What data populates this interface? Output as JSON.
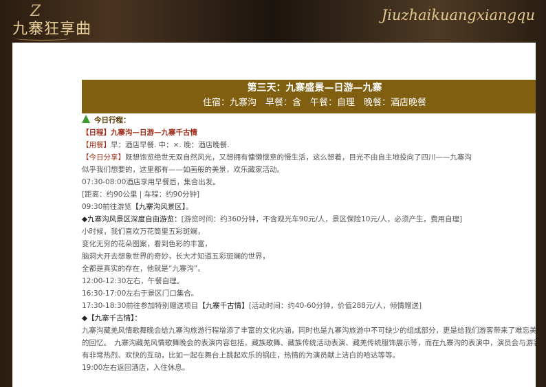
{
  "banner": {
    "logo_seal": "Z",
    "logo_title": "九寨狂享曲",
    "logo_script": "Jiuzhaikuangxiangqu"
  },
  "day": {
    "title": "第三天：九寨盛景—日游—九寨",
    "meta": "住宿：九寨沟　早餐：含　午餐：自理　晚餐：酒店晚餐"
  },
  "itinerary": {
    "today_label": "今日行程：",
    "schedule_prefix": "【日程】",
    "schedule_text": "九寨沟—日游—九寨千古情",
    "meal_prefix": "【用餐】",
    "meal_text": "早：酒店早餐. 中：×. 晚：酒店晚餐.",
    "share_prefix": "【今日分享】",
    "share_text_1": "既想饱览绝世无双自然风光，又想拥有慵懒惬意的慢生活，这么想着，目光不由自主地投向了四川——九寨沟",
    "share_text_2": "似乎我们想要的，这里都有——如画般的美景，欢乐藏家活动。",
    "line_0730": "07:30-08:00酒店享用早餐后，集合出发。",
    "line_distance": "[距离：约90公里 | 车程：约90分钟]",
    "line_0930_a": "09:30前往游览",
    "line_0930_b": "【九寨沟风景区】",
    "line_0930_c": "。",
    "scenic_title": "◆九寨沟风景区深度自由游览：",
    "scenic_detail": "[游览时间：约360分钟，不含观光车90元/人，景区保险10元/人，必须产生，费用自理]",
    "poem_1": "小时候，我们喜欢万花筒里五彩斑斓，",
    "poem_2": "变化无穷的花朵图案，看到色彩的丰富，",
    "poem_3": "脑洞大开去想象世界的奇妙，长大才知道五彩斑斓的世界，",
    "poem_4": "全都是真实的存在，他就是“九寨沟”。",
    "line_1200": "12:00-12:30左右，午餐自理。",
    "line_1630": "16:30-17:00左右于景区门口集合。",
    "line_1730_a": "17:30-18:30前往参加特别赠送项目",
    "line_1730_b": "【九寨千古情】",
    "line_1730_c": "[活动时间：约40-60分钟，价值288元/人，倾情赠送]",
    "show_title": "◆【九寨千古情】：",
    "show_para": "九寨沟藏羌风情歌舞晚会给九寨沟旅游行程增添了丰富的文化内涵，同时也是九寨沟旅游中不可缺少的组成部分，更是给我们游客带来了难忘美好的回忆。　九寨沟藏羌风情歌舞晚会的表演内容包括，藏族歌舞、藏族传统活动表演、藏羌传统服饰展示等，而在九寨沟的表演中，演员会与游客有非常热烈、欢快的互动，比如一起在舞台上跳起欢乐的锅庄，热情的为演员献上洁白的哈达等等。",
    "line_1900": "19:00左右返回酒店，入住休息。"
  },
  "colors": {
    "header_bg": "#806010",
    "accent_red": "#a0301c",
    "tree_green": "#3a9a2a"
  }
}
